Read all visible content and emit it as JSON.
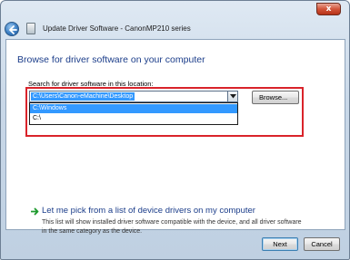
{
  "window": {
    "title": "Update Driver Software - CanonMP210 series",
    "close_label": "x"
  },
  "content": {
    "heading": "Browse for driver software on your computer",
    "search_label": "Search for driver software in this location:",
    "location_value": "C:\\Users\\Canon-eMachine\\Desktop",
    "dropdown_options": [
      "C:\\Windows",
      "C:\\"
    ],
    "browse_label": "Browse...",
    "pick_link": "Let me pick from a list of device drivers on my computer",
    "pick_description": "This list will show installed driver software compatible with the device, and all driver software in the same category as the device."
  },
  "footer": {
    "next_label": "Next",
    "cancel_label": "Cancel"
  },
  "colors": {
    "accent_blue": "#1b3d8a",
    "highlight_red": "#d9232a",
    "selection_blue": "#3399ff",
    "arrow_green": "#1e9a2e"
  },
  "icons": {
    "back": "back-arrow-icon",
    "app": "driver-update-icon",
    "pick": "green-arrow-icon",
    "combo": "chevron-down-icon"
  }
}
